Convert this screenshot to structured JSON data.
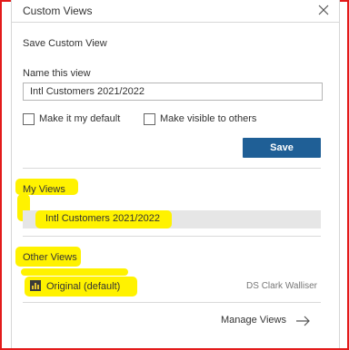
{
  "dialog": {
    "title": "Custom Views",
    "close_icon": "close-icon"
  },
  "save_section": {
    "heading": "Save Custom View",
    "name_label": "Name this view",
    "name_value": "Intl Customers 2021/2022",
    "default_checkbox_label": "Make it my default",
    "visible_checkbox_label": "Make visible to others",
    "default_checked": false,
    "visible_checked": false,
    "save_label": "Save"
  },
  "my_views": {
    "heading": "My Views",
    "items": [
      {
        "label": "Intl Customers 2021/2022"
      }
    ]
  },
  "other_views": {
    "heading": "Other Views",
    "items": [
      {
        "label": "Original (default)",
        "owner": "DS Clark Walliser",
        "icon": "chart-icon"
      }
    ]
  },
  "footer": {
    "manage_label": "Manage Views",
    "arrow_icon": "arrow-right-icon"
  },
  "colors": {
    "accent": "#1f5f96",
    "highlight": "#fff200",
    "frame": "#e31b1b",
    "selected_row": "#e6e6e6"
  }
}
